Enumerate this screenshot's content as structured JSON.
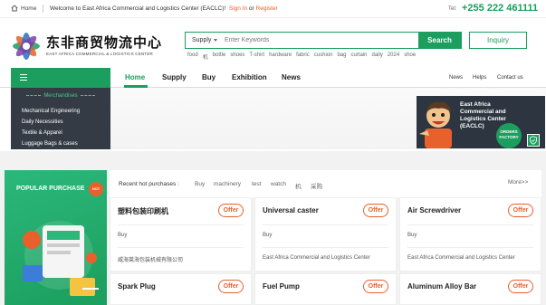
{
  "topbar": {
    "home": "Home",
    "welcome": "Welcome to East Africa Commercial and Logistics Center (EACLC)!",
    "sign_in": "Sign In",
    "or": "or",
    "register": "Register",
    "tel_label": "Tel:",
    "phone": "+255 222 461111"
  },
  "logo": {
    "cn": "东非商贸物流中心",
    "en": "EAST AFRICA COMMERCIAL & LOGISTICS CENTER"
  },
  "search": {
    "scope": "Supply",
    "placeholder": "Enter Keywords",
    "button": "Search",
    "inquiry": "Inquiry",
    "hotwords": [
      "food",
      "机",
      "bottle",
      "shoes",
      "T-shirt",
      "hardware",
      "fabric",
      "cushion",
      "bag",
      "curtain",
      "daily",
      "2024",
      "shoe"
    ]
  },
  "nav": {
    "items": [
      "Home",
      "Supply",
      "Buy",
      "Exhibition",
      "News"
    ],
    "right": [
      "News",
      "Helps",
      "Contact us"
    ]
  },
  "categories": {
    "title": "Merchandises",
    "items": [
      "Mechanical Engineering",
      "Daily Necessities",
      "Textile & Apparel",
      "Luggage Bags & cases"
    ]
  },
  "promo": {
    "title": "East Africa Commercial and Logistics Center (EACLC)",
    "badge": "ORDERS FACTORY"
  },
  "popular": {
    "label": "POPULAR PURCHASE",
    "hot": "HOT"
  },
  "recent": {
    "label": "Recent hot purchases :",
    "keywords": [
      "Buy",
      "machinery",
      "test",
      "watch",
      "机",
      "采购"
    ],
    "more": "More>>"
  },
  "cards": [
    {
      "name": "塑料包装印刷机",
      "offer": "Offer",
      "type": "Buy",
      "company": "威海莱海包装机械有限公司"
    },
    {
      "name": "Universal caster",
      "offer": "Offer",
      "type": "Buy",
      "company": "East Africa Commercial and Logistics Center"
    },
    {
      "name": "Air Screwdriver",
      "offer": "Offer",
      "type": "Buy",
      "company": "East Africa Commercial and Logistics Center"
    },
    {
      "name": "Spark Plug",
      "offer": "Offer"
    },
    {
      "name": "Fuel Pump",
      "offer": "Offer"
    },
    {
      "name": "Aluminum Alloy Bar",
      "offer": "Offer"
    }
  ],
  "colors": {
    "brand_green": "#1b9e5e",
    "accent_orange": "#e8602c",
    "dark_panel": "#343b45"
  }
}
